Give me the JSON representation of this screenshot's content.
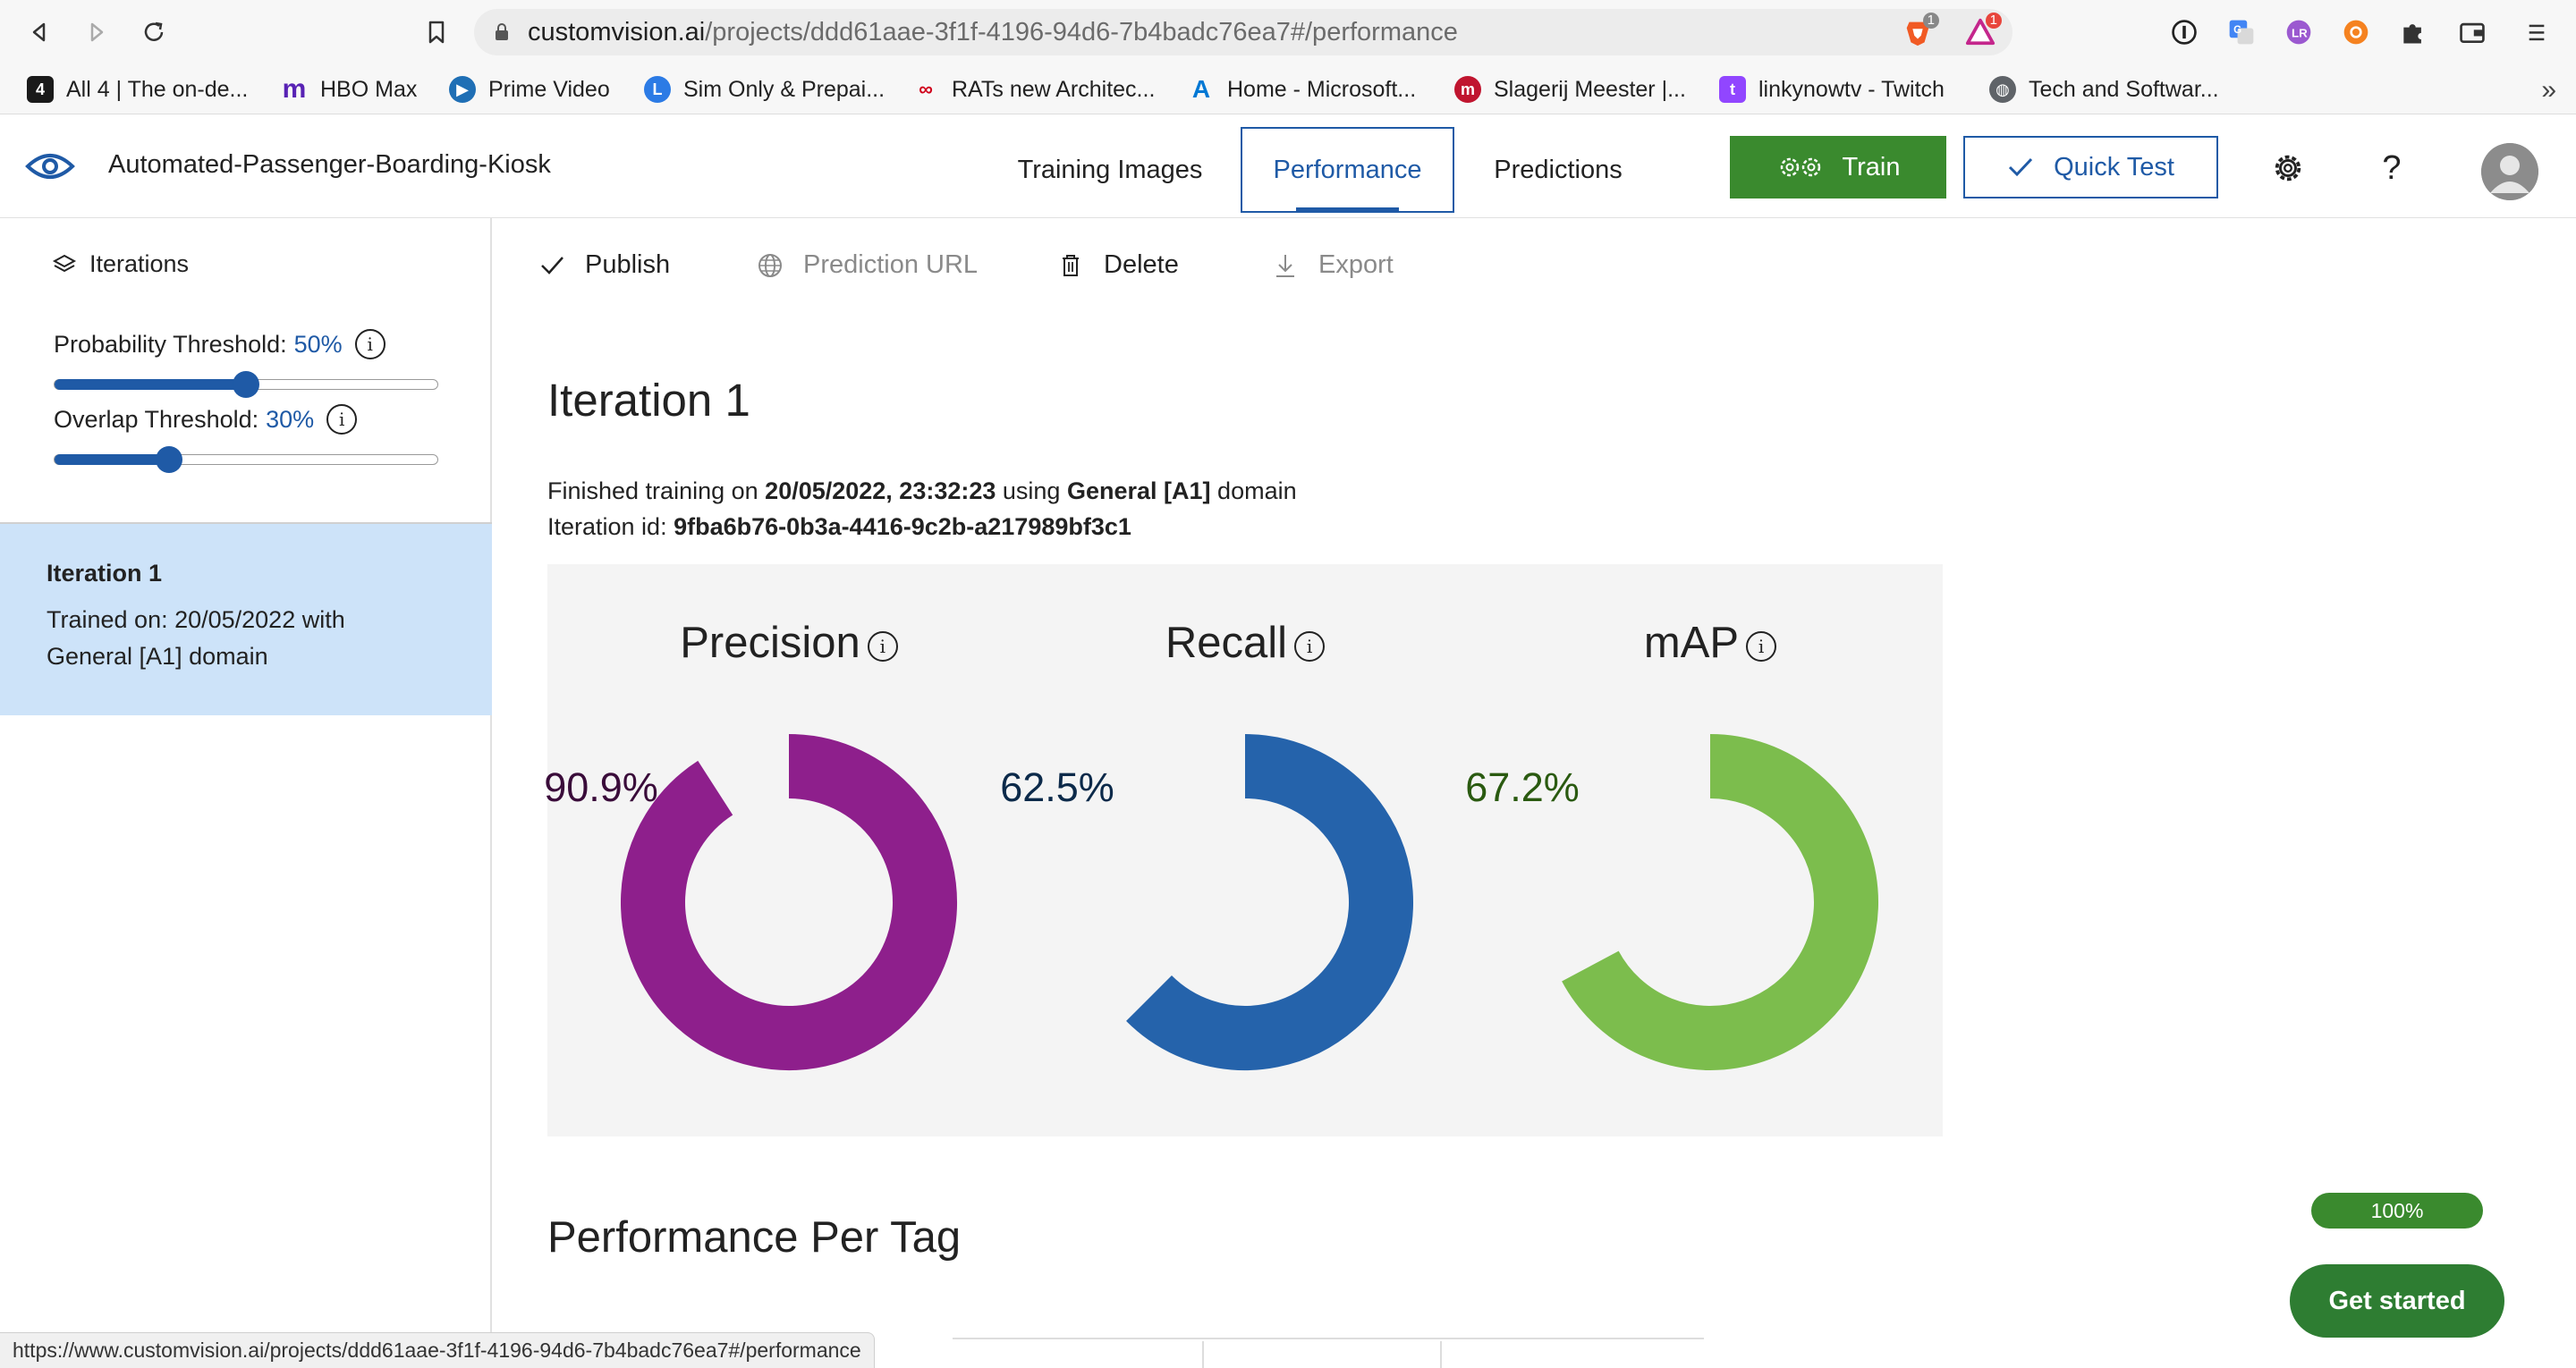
{
  "browser": {
    "url_host": "customvision.ai",
    "url_path": "/projects/ddd61aae-3f1f-4196-94d6-7b4badc76ea7#/performance",
    "brave_badge": "1",
    "rewards_badge": "1",
    "bookmarks": [
      {
        "label": "All 4 | The on-de...",
        "icon": "channel4-icon",
        "color": "#1a1a1a"
      },
      {
        "label": "HBO Max",
        "icon": "hbomax-icon",
        "color": "#5822b4"
      },
      {
        "label": "Prime Video",
        "icon": "primevideo-icon",
        "color": "#1f6fb5"
      },
      {
        "label": "Sim Only & Prepai...",
        "icon": "lyca-icon",
        "color": "#2c7be5"
      },
      {
        "label": "RATs new Architec...",
        "icon": "rats-icon",
        "color": "#d0021b"
      },
      {
        "label": "Home - Microsoft...",
        "icon": "azure-icon",
        "color": "#0078d4"
      },
      {
        "label": "Slagerij Meester |...",
        "icon": "meester-icon",
        "color": "#c0152f"
      },
      {
        "label": "linkynowtv - Twitch",
        "icon": "twitch-icon",
        "color": "#9146ff"
      },
      {
        "label": "Tech and Softwar...",
        "icon": "globe-icon",
        "color": "#5f6368"
      }
    ],
    "status_url": "https://www.customvision.ai/projects/ddd61aae-3f1f-4196-94d6-7b4badc76ea7#/performance"
  },
  "header": {
    "project_name": "Automated-Passenger-Boarding-Kiosk",
    "tabs": [
      {
        "label": "Training Images",
        "active": false
      },
      {
        "label": "Performance",
        "active": true
      },
      {
        "label": "Predictions",
        "active": false
      }
    ],
    "train_label": "Train",
    "quick_test_label": "Quick Test",
    "help_glyph": "?"
  },
  "sidebar": {
    "iterations_label": "Iterations",
    "probability": {
      "label": "Probability Threshold:",
      "value_text": "50%",
      "value": 0.5
    },
    "overlap": {
      "label": "Overlap Threshold:",
      "value_text": "30%",
      "value": 0.3
    },
    "iteration_card": {
      "title": "Iteration 1",
      "description": "Trained on: 20/05/2022 with General [A1] domain"
    }
  },
  "toolbar": {
    "publish": "Publish",
    "prediction_url": "Prediction URL",
    "delete": "Delete",
    "export": "Export"
  },
  "main": {
    "iteration_title": "Iteration 1",
    "trained_prefix": "Finished training on",
    "trained_date": "20/05/2022, 23:32:23",
    "trained_using": "using",
    "domain": "General [A1]",
    "domain_suffix": "domain",
    "iteration_id_label": "Iteration id:",
    "iteration_id": "9fba6b76-0b3a-4416-9c2b-a217989bf3c1",
    "metrics": [
      {
        "name": "Precision",
        "value_text": "90.9%",
        "value": 90.9,
        "color": "#8e1f8c",
        "text_color": "#3a0c3a"
      },
      {
        "name": "Recall",
        "value_text": "62.5%",
        "value": 62.5,
        "color": "#2563ab",
        "text_color": "#0c2a4a"
      },
      {
        "name": "mAP",
        "value_text": "67.2%",
        "value": 67.2,
        "color": "#7cbd4d",
        "text_color": "#2a5a10"
      }
    ],
    "performance_per_tag": "Performance Per Tag"
  },
  "floating": {
    "progress_text": "100%",
    "progress": 1.0,
    "get_started": "Get started"
  },
  "colors": {
    "accent": "#1f5aa6",
    "train_green": "#3a8a2e",
    "selected_iteration": "#cde3f9"
  }
}
